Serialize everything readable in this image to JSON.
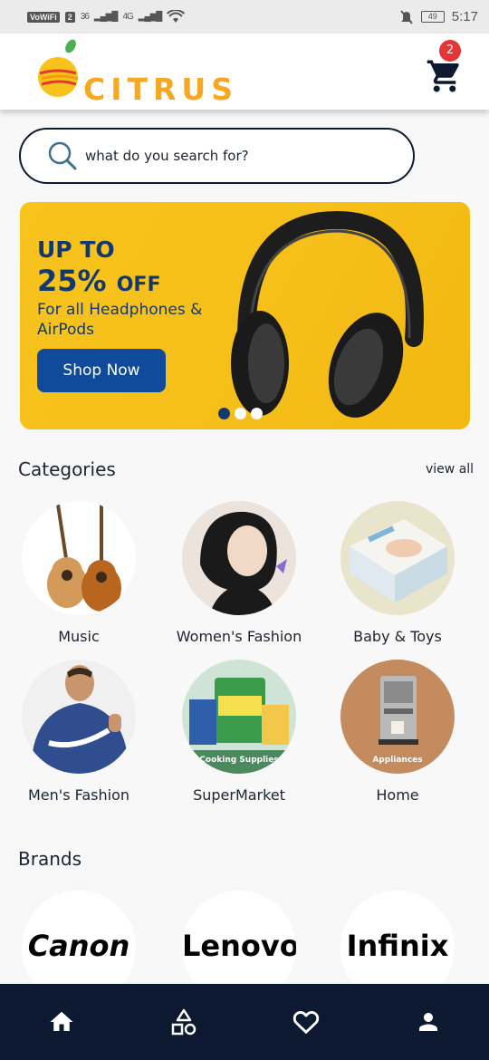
{
  "status_bar": {
    "network_label": "VoWiFi",
    "sim": "2",
    "signal1": "36",
    "signal2": "4G",
    "battery": "49",
    "time": "5:17"
  },
  "header": {
    "brand_name": "CITRUS",
    "cart_count": "2",
    "brand_color": "#f6a821"
  },
  "search": {
    "placeholder": "what do you search for?"
  },
  "banner": {
    "line1": "UP TO",
    "line2_percent": "25%",
    "line2_suffix": "OFF",
    "line3": "For all Headphones & AirPods",
    "button_label": "Shop Now",
    "slides": 3,
    "active_slide": 1
  },
  "categories": {
    "title": "Categories",
    "view_all": "view all",
    "items": [
      {
        "label": "Music",
        "icon": "guitar-image"
      },
      {
        "label": "Women's Fashion",
        "icon": "woman-image"
      },
      {
        "label": "Baby & Toys",
        "icon": "diapers-image"
      },
      {
        "label": "Men's Fashion",
        "icon": "man-hoodie-image"
      },
      {
        "label": "SuperMarket",
        "icon": "cooking-supplies-image",
        "caption": "Cooking Supplies"
      },
      {
        "label": "Home",
        "icon": "coffee-machine-image",
        "caption": "Appliances"
      }
    ]
  },
  "brands": {
    "title": "Brands",
    "items": [
      {
        "name": "Canon"
      },
      {
        "name": "Lenovo"
      },
      {
        "name": "Infinix"
      }
    ]
  },
  "bottom_nav": {
    "items": [
      {
        "icon": "home-icon"
      },
      {
        "icon": "categories-icon"
      },
      {
        "icon": "heart-icon"
      },
      {
        "icon": "profile-icon"
      }
    ]
  },
  "colors": {
    "navy": "#0c1931",
    "banner_yellow": "#f7c31c",
    "banner_text": "#13386f",
    "badge_red": "#e53535"
  }
}
